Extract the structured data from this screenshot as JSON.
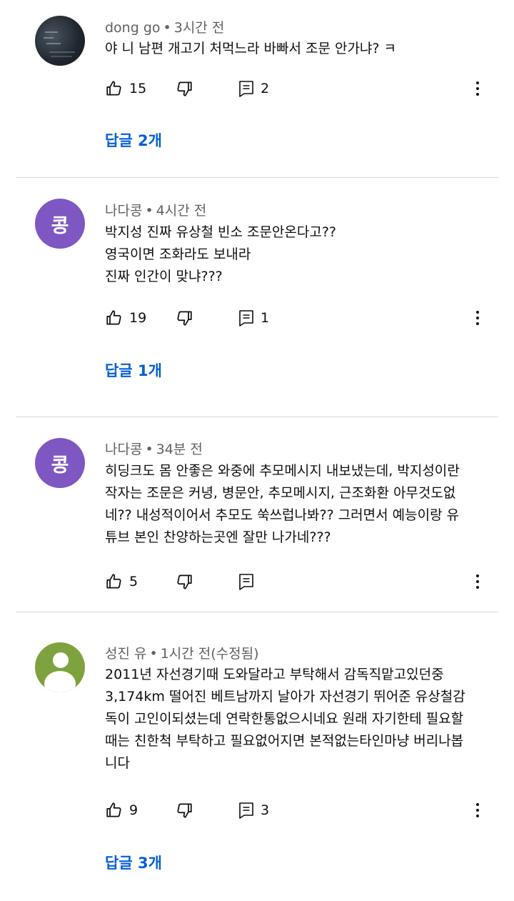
{
  "comments": [
    {
      "author": "dong go",
      "time": "3시간 전",
      "lines": [
        "야 니 남편 개고기 처먹느라 바빠서 조문 안가냐? ㅋ"
      ],
      "likes": "15",
      "reply_count": "2",
      "replies_label": "답글 2개",
      "avatar": {
        "type": "photo",
        "icon": "dark-photo-avatar"
      }
    },
    {
      "author": "나다콩",
      "time": "4시간 전",
      "lines": [
        "박지성 진짜 유상철 빈소 조문안온다고??",
        "영국이면 조화라도 보내라",
        "진짜 인간이 맞냐???"
      ],
      "likes": "19",
      "reply_count": "1",
      "replies_label": "답글 1개",
      "avatar": {
        "type": "letter",
        "letter": "콩",
        "color": "#7e57c2"
      }
    },
    {
      "author": "나다콩",
      "time": "34분 전",
      "lines": [
        "히딩크도 몸 안좋은 와중에 추모메시지 내보냈는데,  박지성이란",
        "작자는 조문은 커녕, 병문안, 추모메시지, 근조화환  아무것도없",
        "네??  내성적이어서 추모도 쑥쓰럽나봐??  그러면서 예능이랑 유",
        "튜브 본인 찬양하는곳엔 잘만 나가네???"
      ],
      "likes": "5",
      "reply_count": "",
      "replies_label": "",
      "avatar": {
        "type": "letter",
        "letter": "콩",
        "color": "#7e57c2"
      }
    },
    {
      "author": "성진 유",
      "time": "1시간 전(수정됨)",
      "lines": [
        "2011년 자선경기때 도와달라고 부탁해서 감독직맡고있던중",
        "3,174km 떨어진 베트남까지 날아가 자선경기 뛰어준 유상철감",
        "독이 고인이되셨는데 연락한통없으시네요 원래 자기한테 필요할",
        "때는 친한척 부탁하고 필요없어지면 본적없는타인마냥 버리나봅",
        "니다"
      ],
      "likes": "9",
      "reply_count": "3",
      "replies_label": "답글 3개",
      "avatar": {
        "type": "default",
        "color": "#7ea33e",
        "icon": "default-user-icon"
      }
    }
  ],
  "meta_separator": "•",
  "icons": {
    "like": "thumbs-up-icon",
    "dislike": "thumbs-down-icon",
    "reply": "reply-icon",
    "more": "more-vert-icon"
  },
  "colors": {
    "link": "#065fd4",
    "meta": "#606060",
    "divider": "#d7d7d7"
  }
}
